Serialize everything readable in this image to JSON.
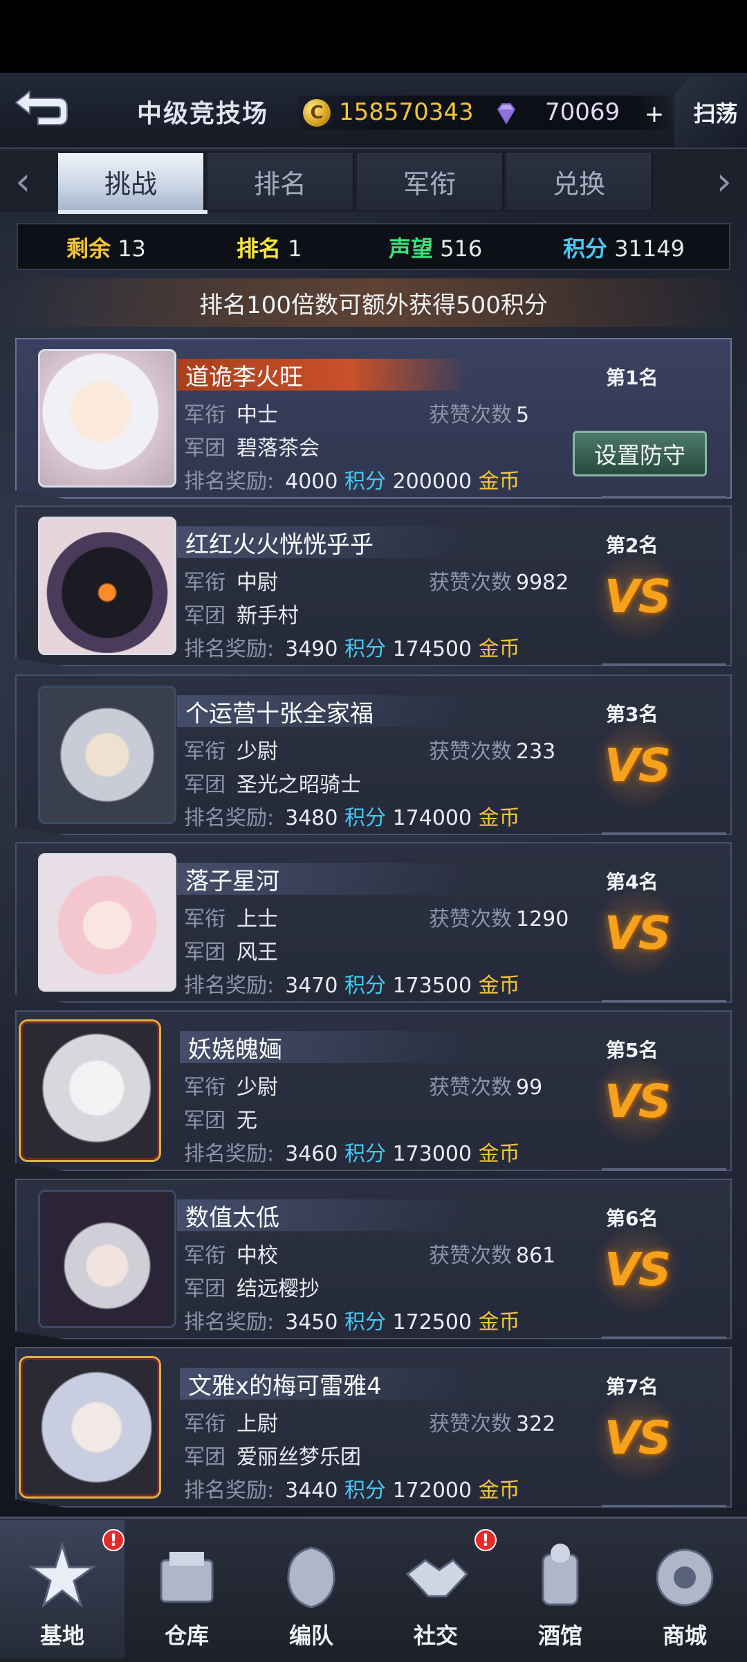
{
  "header": {
    "title": "中级竞技场",
    "coins": "158570343",
    "gems": "70069",
    "plus": "+",
    "sweep": "扫荡"
  },
  "tabs": [
    "挑战",
    "排名",
    "军衔",
    "兑换"
  ],
  "stats": {
    "remaining_label": "剩余",
    "remaining": "13",
    "rank_label": "排名",
    "rank": "1",
    "prestige_label": "声望",
    "prestige": "516",
    "points_label": "积分",
    "points": "31149"
  },
  "notice": "排名100倍数可额外获得500积分",
  "labels": {
    "rank_title": "军衔",
    "legion": "军团",
    "likes": "获赞次数",
    "reward": "排名奖励:",
    "points_unit": "积分",
    "coins_unit": "金币",
    "defend_button": "设置防守",
    "vs": "VS"
  },
  "players": [
    {
      "rank": "第1名",
      "name": "道诡李火旺",
      "military_rank": "中士",
      "legion": "碧落茶会",
      "likes": "5",
      "reward_points": "4000",
      "reward_coins": "200000"
    },
    {
      "rank": "第2名",
      "name": "红红火火恍恍乎乎",
      "military_rank": "中尉",
      "legion": "新手村",
      "likes": "9982",
      "reward_points": "3490",
      "reward_coins": "174500"
    },
    {
      "rank": "第3名",
      "name": "个运营十张全家福",
      "military_rank": "少尉",
      "legion": "圣光之昭骑士",
      "likes": "233",
      "reward_points": "3480",
      "reward_coins": "174000"
    },
    {
      "rank": "第4名",
      "name": "落子星河",
      "military_rank": "上士",
      "legion": "风王",
      "likes": "1290",
      "reward_points": "3470",
      "reward_coins": "173500"
    },
    {
      "rank": "第5名",
      "name": "妖娆魄婳",
      "military_rank": "少尉",
      "legion": "无",
      "likes": "99",
      "reward_points": "3460",
      "reward_coins": "173000"
    },
    {
      "rank": "第6名",
      "name": "数值太低",
      "military_rank": "中校",
      "legion": "结远樱抄",
      "likes": "861",
      "reward_points": "3450",
      "reward_coins": "172500"
    },
    {
      "rank": "第7名",
      "name": "文雅x的梅可雷雅4",
      "military_rank": "上尉",
      "legion": "爱丽丝梦乐团",
      "likes": "322",
      "reward_points": "3440",
      "reward_coins": "172000"
    }
  ],
  "nav": [
    {
      "label": "基地",
      "icon": "base-icon"
    },
    {
      "label": "仓库",
      "icon": "warehouse-icon"
    },
    {
      "label": "编队",
      "icon": "formation-icon"
    },
    {
      "label": "社交",
      "icon": "social-icon"
    },
    {
      "label": "酒馆",
      "icon": "tavern-icon"
    },
    {
      "label": "商城",
      "icon": "shop-icon"
    }
  ],
  "badge": "!",
  "colors": {
    "gold": "#f3c53a",
    "blue": "#47c9f3",
    "green": "#3fe07a",
    "vs_orange": "#f6a21c",
    "name_highlight": "#c9502a"
  }
}
